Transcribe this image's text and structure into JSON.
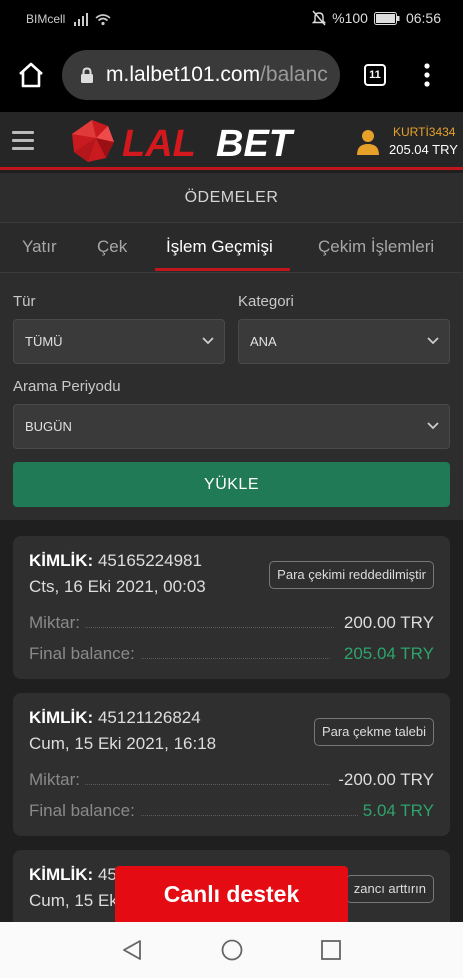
{
  "status_bar": {
    "carrier": "BIMcell",
    "battery": "%100",
    "time": "06:56"
  },
  "browser": {
    "url_main": "m.lalbet101.com",
    "url_rest": "/balanc",
    "tab_count": "11"
  },
  "header": {
    "logo_text": "LALBET",
    "username": "KURTİ3434",
    "balance": "205.04 TRY"
  },
  "page_title": "ÖDEMELER",
  "tabs": [
    {
      "label": "Yatır"
    },
    {
      "label": "Çek"
    },
    {
      "label": "İşlem Geçmişi"
    },
    {
      "label": "Çekim İşlemleri"
    }
  ],
  "filters": {
    "type_label": "Tür",
    "type_value": "TÜMÜ",
    "category_label": "Kategori",
    "category_value": "ANA",
    "period_label": "Arama Periyodu",
    "period_value": "BUGÜN",
    "load_button": "YÜKLE"
  },
  "transactions": [
    {
      "id_label": "KİMLİK:",
      "id": "45165224981",
      "date": "Cts, 16 Eki 2021, 00:03",
      "status": "Para çekimi reddedilmiştir",
      "amount_label": "Miktar:",
      "amount": "200.00 TRY",
      "final_label": "Final balance:",
      "final": "205.04 TRY"
    },
    {
      "id_label": "KİMLİK:",
      "id": "45121126824",
      "date": "Cum, 15 Eki 2021, 16:18",
      "status": "Para çekme talebi",
      "amount_label": "Miktar:",
      "amount": "-200.00 TRY",
      "final_label": "Final balance:",
      "final": "5.04 TRY"
    },
    {
      "id_label": "KİMLİK:",
      "id": "45",
      "date": "Cum, 15 Ek",
      "status": "zancı arttırın"
    }
  ],
  "live_support": "Canlı destek",
  "colors": {
    "brand_red": "#c0161b",
    "support_red": "#e50b12",
    "load_green": "#1f7a55",
    "positive_green": "#2fa36b",
    "username_orange": "#e7a12a"
  }
}
